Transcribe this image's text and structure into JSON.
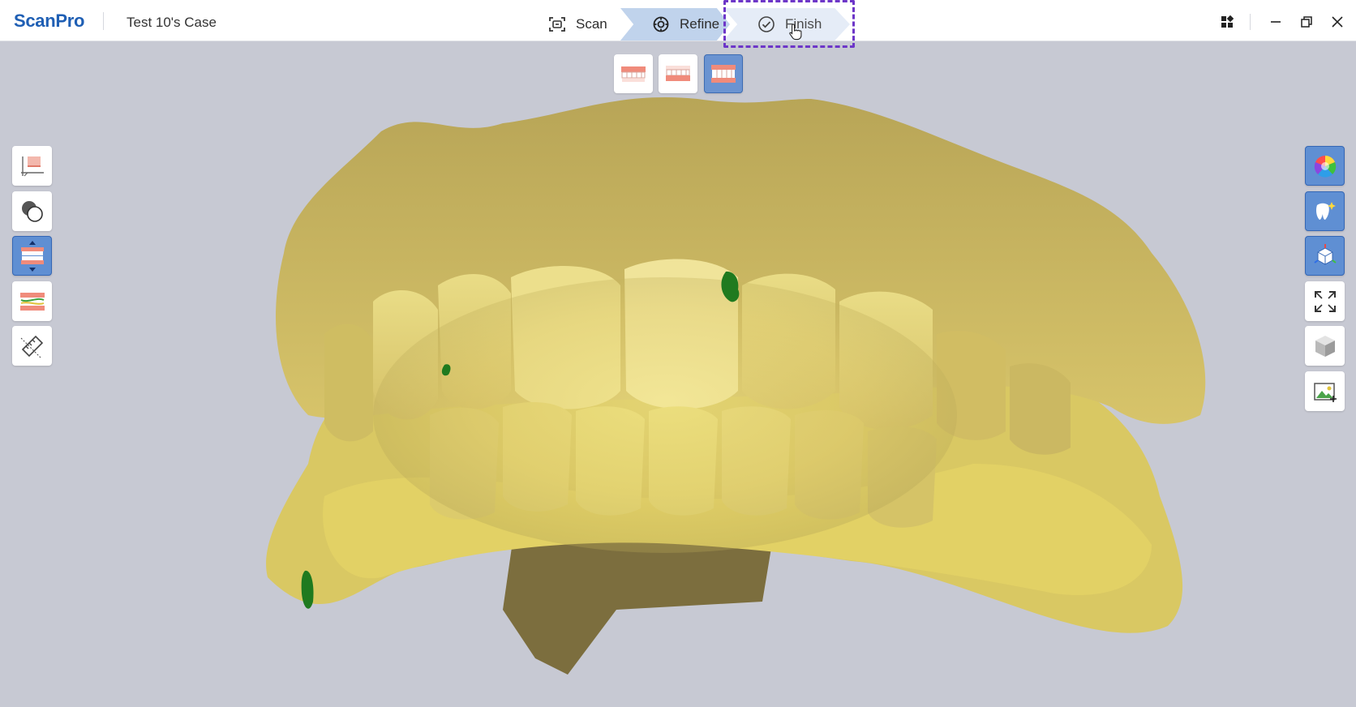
{
  "app": {
    "logo": "ScanPro",
    "case_name": "Test 10's Case"
  },
  "steps": [
    {
      "label": "Scan",
      "icon": "scan-icon"
    },
    {
      "label": "Refine",
      "icon": "refine-gear-icon"
    },
    {
      "label": "Finish",
      "icon": "check-circle-icon"
    }
  ],
  "window_controls": [
    "grid-menu-icon",
    "minimize-icon",
    "restore-icon",
    "close-icon"
  ],
  "view_buttons": [
    {
      "name": "upper-jaw-view",
      "active": false
    },
    {
      "name": "lower-jaw-view",
      "active": false
    },
    {
      "name": "both-jaws-view",
      "active": true
    }
  ],
  "left_tools": [
    {
      "name": "trim-base-tool",
      "active": false
    },
    {
      "name": "overlay-tool",
      "active": false
    },
    {
      "name": "bite-align-tool",
      "active": true
    },
    {
      "name": "occlusion-map-tool",
      "active": false
    },
    {
      "name": "measure-ruler-tool",
      "active": false
    }
  ],
  "right_tools": [
    {
      "name": "color-wheel-tool",
      "active": true
    },
    {
      "name": "tooth-highlight-tool",
      "active": true
    },
    {
      "name": "3d-axis-tool",
      "active": true
    },
    {
      "name": "fit-view-tool",
      "active": false
    },
    {
      "name": "cube-view-tool",
      "active": false
    },
    {
      "name": "snapshot-image-tool",
      "active": false
    }
  ],
  "colors": {
    "accent": "#6d36c8",
    "brand": "#1f5fb4",
    "active_tool": "#5f8fd3",
    "model": "#d9c66a",
    "marker": "#1f7a1f"
  }
}
